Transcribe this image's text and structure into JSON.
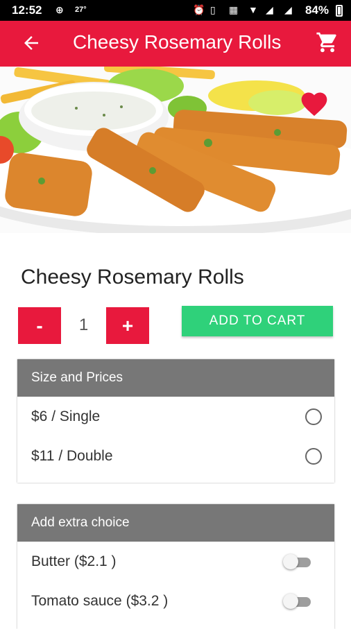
{
  "status_bar": {
    "time": "12:52",
    "temp": "27°",
    "battery": "84%"
  },
  "app_bar": {
    "title": "Cheesy Rosemary Rolls"
  },
  "product": {
    "title": "Cheesy Rosemary Rolls",
    "quantity": "1",
    "minus_label": "-",
    "plus_label": "+",
    "add_to_cart": "ADD TO CART"
  },
  "sizes": {
    "header": "Size and Prices",
    "options": [
      {
        "label": "$6 / Single",
        "selected": false
      },
      {
        "label": "$11 / Double",
        "selected": false
      }
    ]
  },
  "extras": {
    "header": "Add extra choice",
    "options": [
      {
        "label": "Butter ($2.1 )",
        "enabled": false
      },
      {
        "label": "Tomato sauce ($3.2 )",
        "enabled": false
      }
    ]
  },
  "colors": {
    "brand": "#e8193d",
    "accent": "#2fd17a",
    "section_header": "#777777"
  },
  "icons": {
    "back": "arrow-left-icon",
    "cart": "shopping-cart-icon",
    "favorite": "heart-icon"
  }
}
